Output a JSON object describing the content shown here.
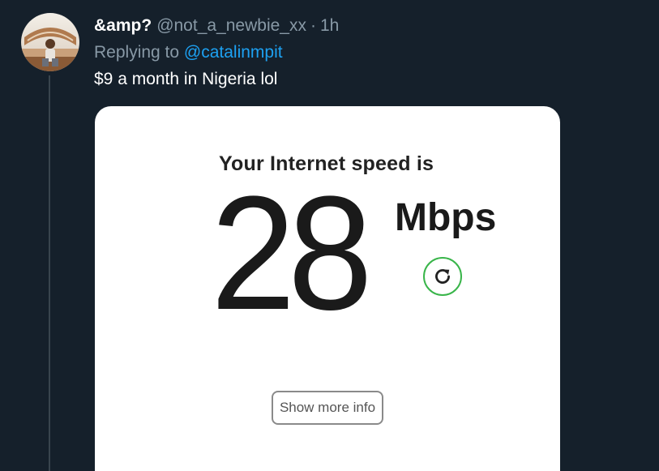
{
  "tweet": {
    "display_name": "&amp?",
    "handle": "@not_a_newbie_xx",
    "separator": "·",
    "time": "1h",
    "replying_prefix": "Replying to",
    "replying_to": "@catalinmpit",
    "text": "$9 a month in Nigeria lol"
  },
  "media": {
    "speed_label": "Your Internet speed is",
    "speed_value": "28",
    "speed_unit": "Mbps",
    "more_info_label": "Show more info",
    "accent_color": "#39b54a"
  },
  "icons": {
    "refresh": "refresh-icon",
    "avatar": "profile-photo"
  },
  "theme": {
    "background": "#15202b",
    "muted_text": "#8899a6",
    "link": "#1da1f2"
  }
}
